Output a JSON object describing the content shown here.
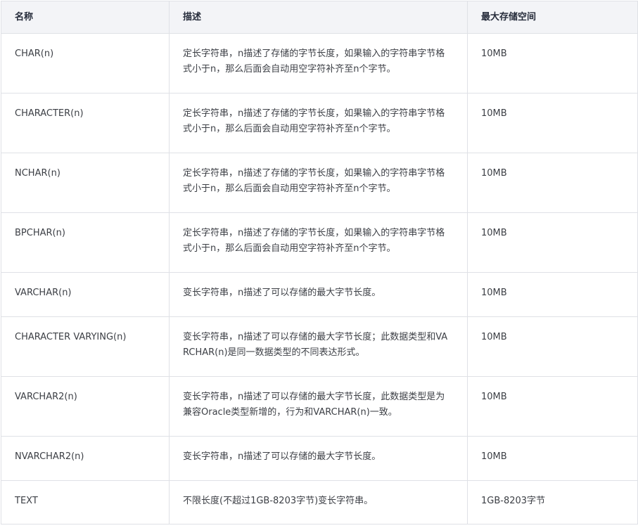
{
  "table": {
    "headers": [
      "名称",
      "描述",
      "最大存储空间"
    ],
    "rows": [
      {
        "name": "CHAR(n)",
        "description": "定长字符串，n描述了存储的字节长度，如果输入的字符串字节格式小于n，那么后面会自动用空字符补齐至n个字节。",
        "max_storage": "10MB"
      },
      {
        "name": "CHARACTER(n)",
        "description": "定长字符串，n描述了存储的字节长度，如果输入的字符串字节格式小于n，那么后面会自动用空字符补齐至n个字节。",
        "max_storage": "10MB"
      },
      {
        "name": "NCHAR(n)",
        "description": "定长字符串，n描述了存储的字节长度，如果输入的字符串字节格式小于n，那么后面会自动用空字符补齐至n个字节。",
        "max_storage": "10MB"
      },
      {
        "name": "BPCHAR(n)",
        "description": "定长字符串，n描述了存储的字节长度，如果输入的字符串字节格式小于n，那么后面会自动用空字符补齐至n个字节。",
        "max_storage": "10MB"
      },
      {
        "name": "VARCHAR(n)",
        "description": "变长字符串，n描述了可以存储的最大字节长度。",
        "max_storage": "10MB"
      },
      {
        "name": "CHARACTER VARYING(n)",
        "description": "变长字符串，n描述了可以存储的最大字节长度；此数据类型和VARCHAR(n)是同一数据类型的不同表达形式。",
        "max_storage": "10MB"
      },
      {
        "name": "VARCHAR2(n)",
        "description": "变长字符串，n描述了可以存储的最大字节长度，此数据类型是为兼容Oracle类型新增的，行为和VARCHAR(n)一致。",
        "max_storage": "10MB"
      },
      {
        "name": "NVARCHAR2(n)",
        "description": "变长字符串，n描述了可以存储的最大字节长度。",
        "max_storage": "10MB"
      },
      {
        "name": "TEXT",
        "description": "不限长度(不超过1GB-8203字节)变长字符串。",
        "max_storage": "1GB-8203字节"
      }
    ]
  }
}
